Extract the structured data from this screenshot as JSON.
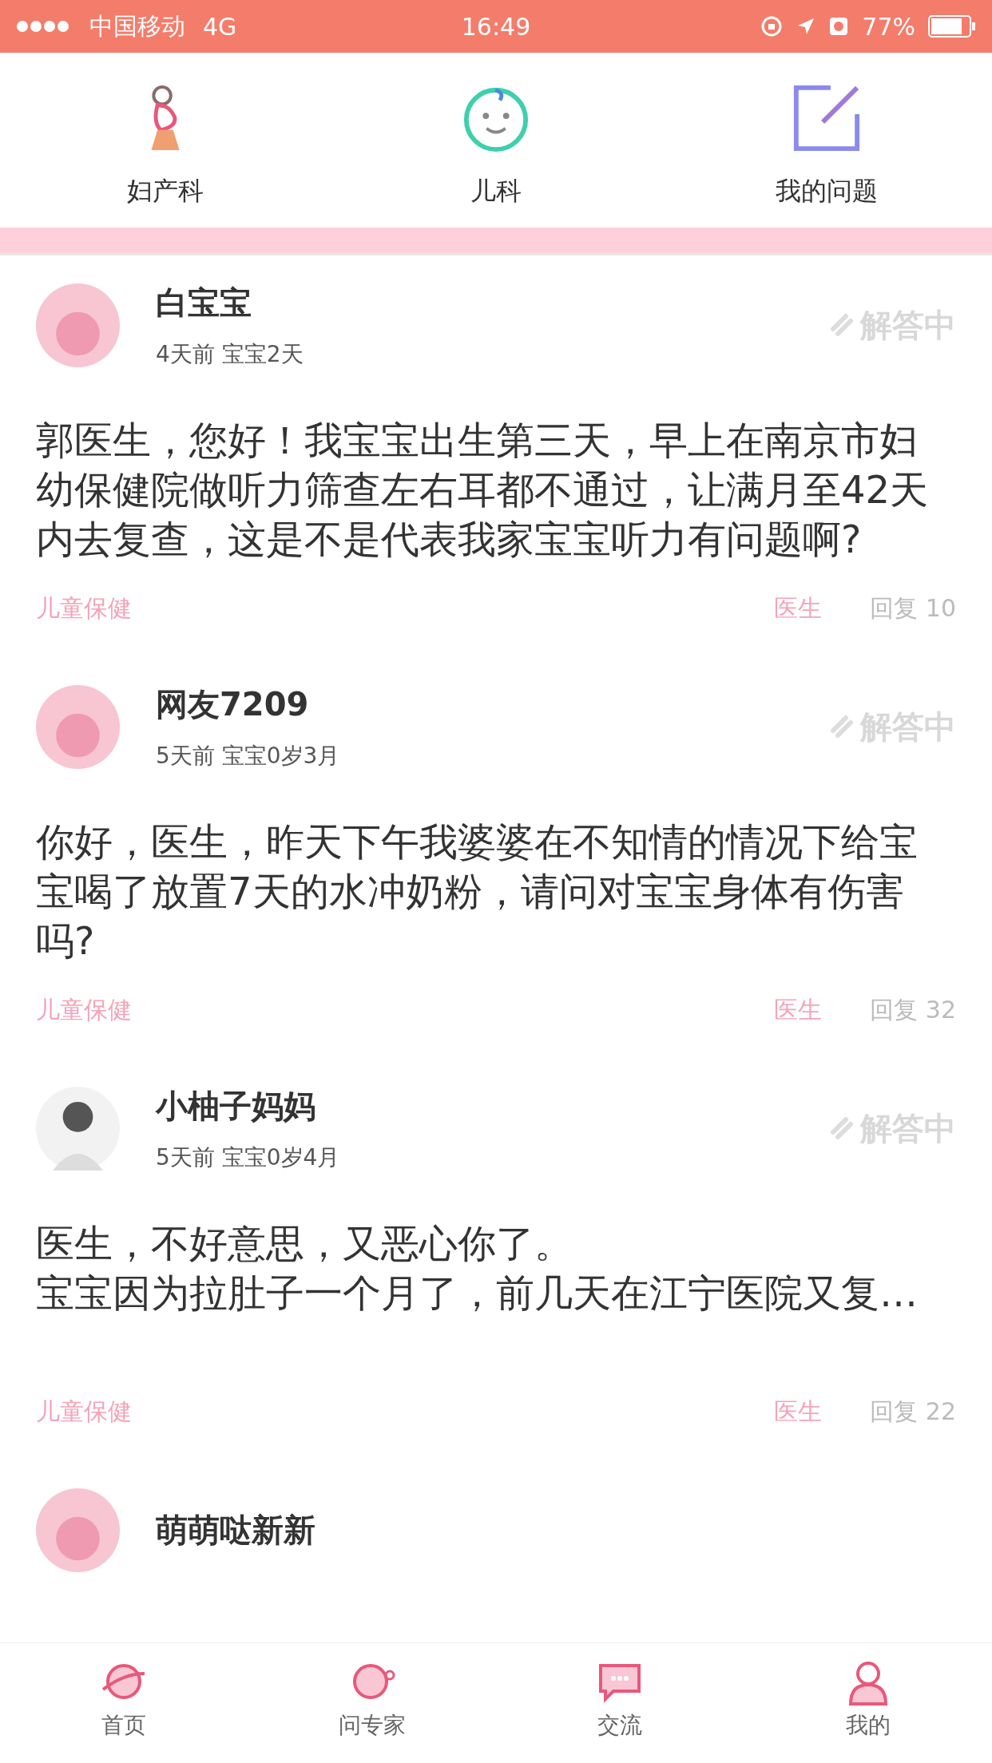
{
  "status_bar": {
    "carrier": "中国移动",
    "network": "4G",
    "time": "16:49",
    "battery": "77%"
  },
  "categories": [
    {
      "kind": "pregnant",
      "label": "妇产科"
    },
    {
      "kind": "baby",
      "label": "儿科"
    },
    {
      "kind": "edit",
      "label": "我的问题"
    }
  ],
  "posts": [
    {
      "user": "白宝宝",
      "meta": "4天前 宝宝2天",
      "status": "解答中",
      "body": [
        "郭医生，您好！我宝宝出生第三天，早上在南京市妇幼保健院做听力筛查左右耳都不通过，让满月至42天内去复查，这是不是代表我家宝宝听力有问题啊?"
      ],
      "tag": "儿童保健",
      "answerer": "医生",
      "replies": "回复 10"
    },
    {
      "user": "网友7209",
      "meta": "5天前 宝宝0岁3月",
      "status": "解答中",
      "body": [
        "你好，医生，昨天下午我婆婆在不知情的情况下给宝宝喝了放置7天的水冲奶粉，请问对宝宝身体有伤害吗?"
      ],
      "tag": "儿童保健",
      "answerer": "医生",
      "replies": "回复 32"
    },
    {
      "user": "小柚子妈妈",
      "meta": "5天前 宝宝0岁4月",
      "status": "解答中",
      "body": [
        "医生，不好意思，又恶心你了。",
        "宝宝因为拉肚子一个月了，前几天在江宁医院又复…"
      ],
      "tag": "儿童保健",
      "answerer": "医生",
      "replies": "回复 22"
    },
    {
      "user": "萌萌哒新新"
    }
  ],
  "tab_bar": [
    {
      "kind": "home",
      "label": "首页"
    },
    {
      "kind": "expert",
      "label": "问专家"
    },
    {
      "kind": "chat",
      "label": "交流"
    },
    {
      "kind": "me",
      "label": "我的"
    }
  ]
}
